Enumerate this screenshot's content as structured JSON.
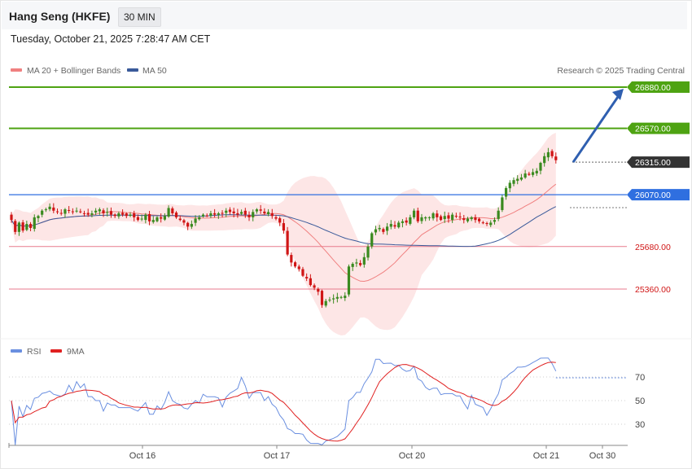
{
  "header": {
    "title": "Hang Seng (HKFE)",
    "timeframe": "30 MIN",
    "datetime": "Tuesday, October 21, 2025 7:28:47 AM CET"
  },
  "credit": "Research © 2025 Trading Central",
  "legend": {
    "ma20": "MA 20 + Bollinger Bands",
    "ma50": "MA 50",
    "rsi": "RSI",
    "rsi_ma": "9MA"
  },
  "colors": {
    "up": "#3a8a1f",
    "down": "#d01515",
    "ma20": "#f08080",
    "ma50": "#3a5a9a",
    "band": "#fde2e2",
    "resistance": "#4ea312",
    "pivot": "#2f6fe0",
    "support": "#e87a8c",
    "last": "#333333",
    "rsi": "#6a8fe0",
    "rsi_ma": "#e02020",
    "arrow": "#2f5fb0"
  },
  "chart_data": {
    "type": "candlestick",
    "price_range": [
      25180,
      26940
    ],
    "levels": [
      {
        "label": "26880.00",
        "value": 26880,
        "kind": "resistance"
      },
      {
        "label": "26570.00",
        "value": 26570,
        "kind": "resistance"
      },
      {
        "label": "26315.00",
        "value": 26315,
        "kind": "last"
      },
      {
        "label": "26070.00",
        "value": 26070,
        "kind": "pivot"
      },
      {
        "label": "25680.00",
        "value": 25680,
        "kind": "support"
      },
      {
        "label": "25360.00",
        "value": 25360,
        "kind": "support"
      }
    ],
    "x_labels": [
      "Oct 16",
      "Oct 17",
      "Oct 20",
      "Oct 21",
      "Oct 30"
    ],
    "rsi_levels": [
      "70",
      "50",
      "30"
    ],
    "rsi_range": [
      0,
      100
    ],
    "arrow": {
      "from": 26315,
      "to": 26880
    },
    "closes": [
      25880,
      25790,
      25860,
      25800,
      25850,
      25820,
      25900,
      25910,
      25950,
      25960,
      25980,
      25950,
      25940,
      25930,
      25960,
      25950,
      25940,
      25950,
      25940,
      25930,
      25920,
      25930,
      25950,
      25960,
      25930,
      25940,
      25920,
      25910,
      25930,
      25920,
      25910,
      25920,
      25900,
      25880,
      25890,
      25920,
      25870,
      25880,
      25900,
      25890,
      25910,
      25970,
      25930,
      25900,
      25880,
      25860,
      25830,
      25850,
      25890,
      25900,
      25920,
      25910,
      25930,
      25920,
      25930,
      25930,
      25950,
      25940,
      25930,
      25920,
      25940,
      25920,
      25900,
      25940,
      25960,
      25950,
      25930,
      25940,
      25910,
      25890,
      25860,
      25800,
      25620,
      25560,
      25530,
      25510,
      25460,
      25440,
      25390,
      25370,
      25340,
      25240,
      25270,
      25280,
      25290,
      25300,
      25300,
      25310,
      25530,
      25550,
      25560,
      25540,
      25600,
      25680,
      25780,
      25810,
      25820,
      25790,
      25830,
      25850,
      25830,
      25860,
      25870,
      25860,
      25900,
      25950,
      25870,
      25900,
      25900,
      25900,
      25930,
      25900,
      25880,
      25910,
      25890,
      25920,
      25910,
      25900,
      25880,
      25890,
      25900,
      25880,
      25870,
      25860,
      25850,
      25860,
      25880,
      25950,
      26050,
      26120,
      26160,
      26180,
      26190,
      26200,
      26230,
      26220,
      26240,
      26250,
      26310,
      26360,
      26390,
      26360,
      26330
    ]
  }
}
